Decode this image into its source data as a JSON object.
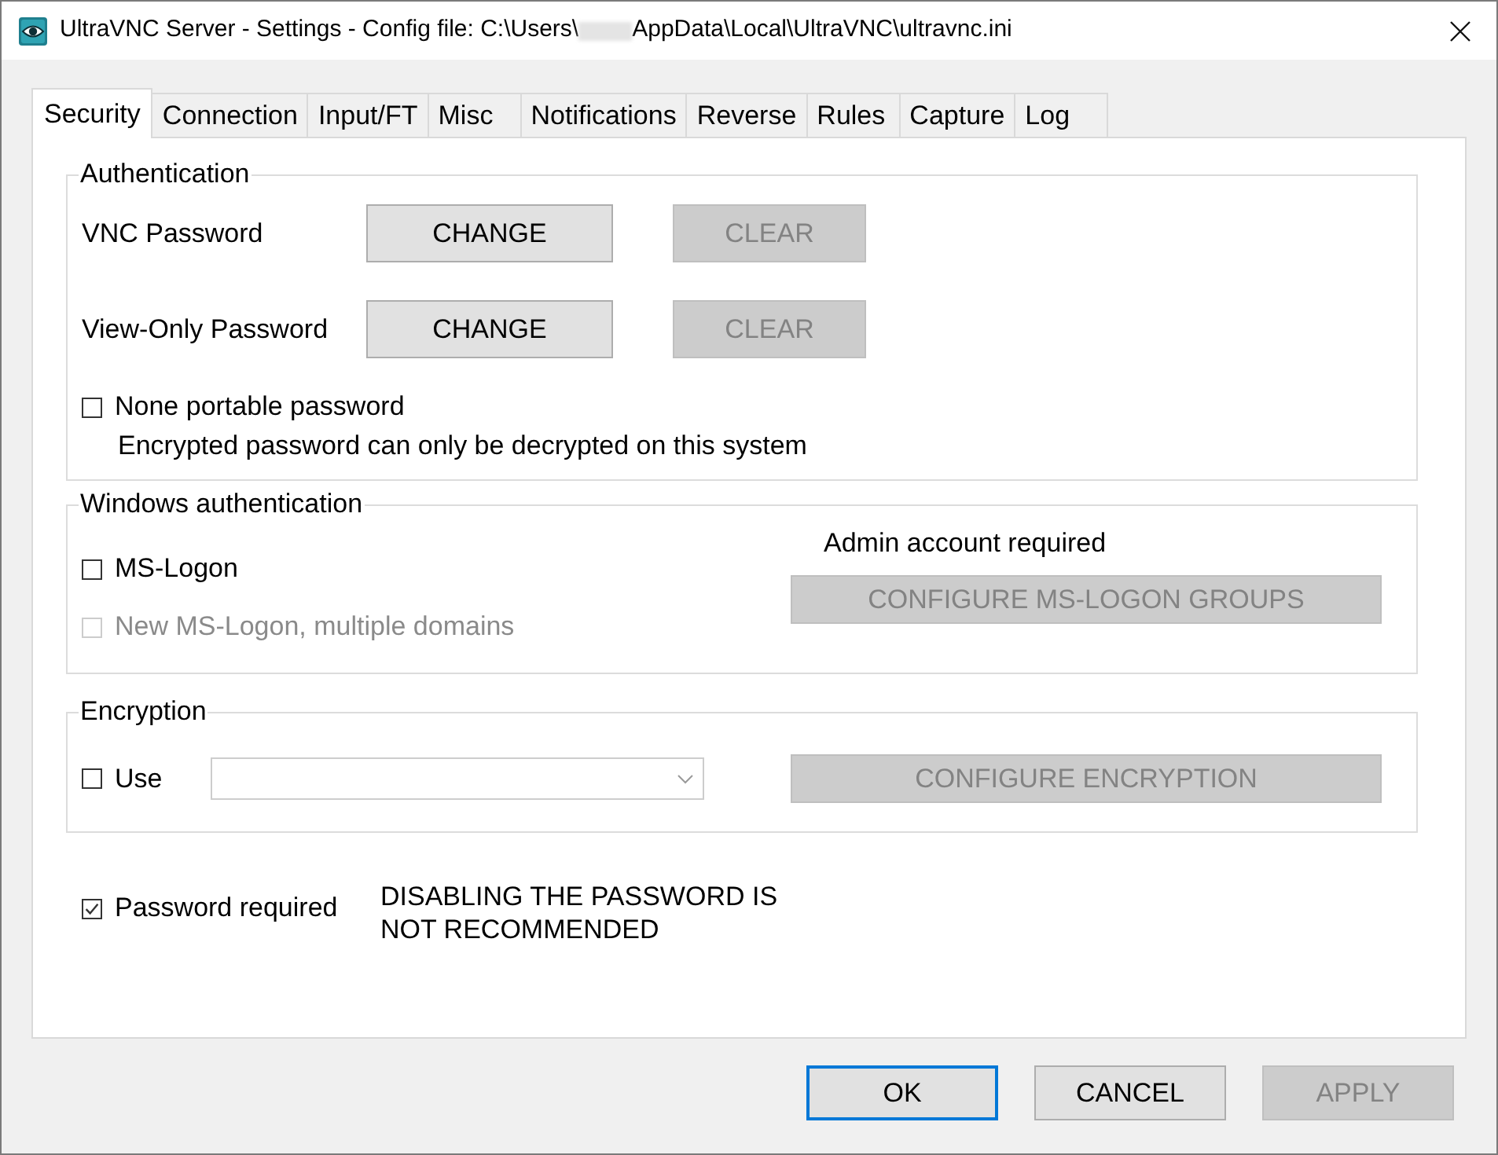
{
  "window": {
    "title": "UltraVNC Server - Settings - Config file: C:\\Users\\",
    "title_rest": "AppData\\Local\\UltraVNC\\ultravnc.ini"
  },
  "tabs": [
    {
      "label": "Security",
      "selected": true
    },
    {
      "label": "Connection",
      "selected": false
    },
    {
      "label": "Input/FT",
      "selected": false
    },
    {
      "label": "Misc",
      "selected": false
    },
    {
      "label": "Notifications",
      "selected": false
    },
    {
      "label": "Reverse",
      "selected": false
    },
    {
      "label": "Rules",
      "selected": false
    },
    {
      "label": "Capture",
      "selected": false
    },
    {
      "label": "Log",
      "selected": false
    }
  ],
  "authentication": {
    "title": "Authentication",
    "rows": [
      {
        "label": "VNC Password",
        "buttons": [
          {
            "label": "CHANGE",
            "disabled": false
          },
          {
            "label": "CLEAR",
            "disabled": true
          }
        ]
      },
      {
        "label": "View-Only Password",
        "buttons": [
          {
            "label": "CHANGE",
            "disabled": false
          },
          {
            "label": "CLEAR",
            "disabled": true
          }
        ]
      }
    ],
    "checkbox": {
      "label": "None portable password",
      "checked": false,
      "disabled": false
    },
    "note": "Encrypted password can only be decrypted on this system"
  },
  "windows_authentication": {
    "title": "Windows authentication",
    "checkboxes": [
      {
        "label": "MS-Logon",
        "checked": false,
        "disabled": false
      },
      {
        "label": "New MS-Logon, multiple domains",
        "checked": false,
        "disabled": true
      }
    ],
    "note": "Admin account required",
    "button": {
      "label": "CONFIGURE MS-LOGON GROUPS",
      "disabled": true
    }
  },
  "encryption": {
    "title": "Encryption",
    "checkbox": {
      "label": "Use",
      "checked": false,
      "disabled": false
    },
    "button": {
      "label": "CONFIGURE ENCRYPTION",
      "disabled": true
    }
  },
  "password_required": {
    "checkbox": {
      "label": "Password required",
      "checked": true,
      "disabled": false
    },
    "warning": "DISABLING THE PASSWORD IS NOT RECOMMENDED"
  },
  "buttons": [
    {
      "label": "OK",
      "focused": true,
      "disabled": false
    },
    {
      "label": "CANCEL",
      "focused": false,
      "disabled": false
    },
    {
      "label": "APPLY",
      "focused": false,
      "disabled": true
    }
  ]
}
